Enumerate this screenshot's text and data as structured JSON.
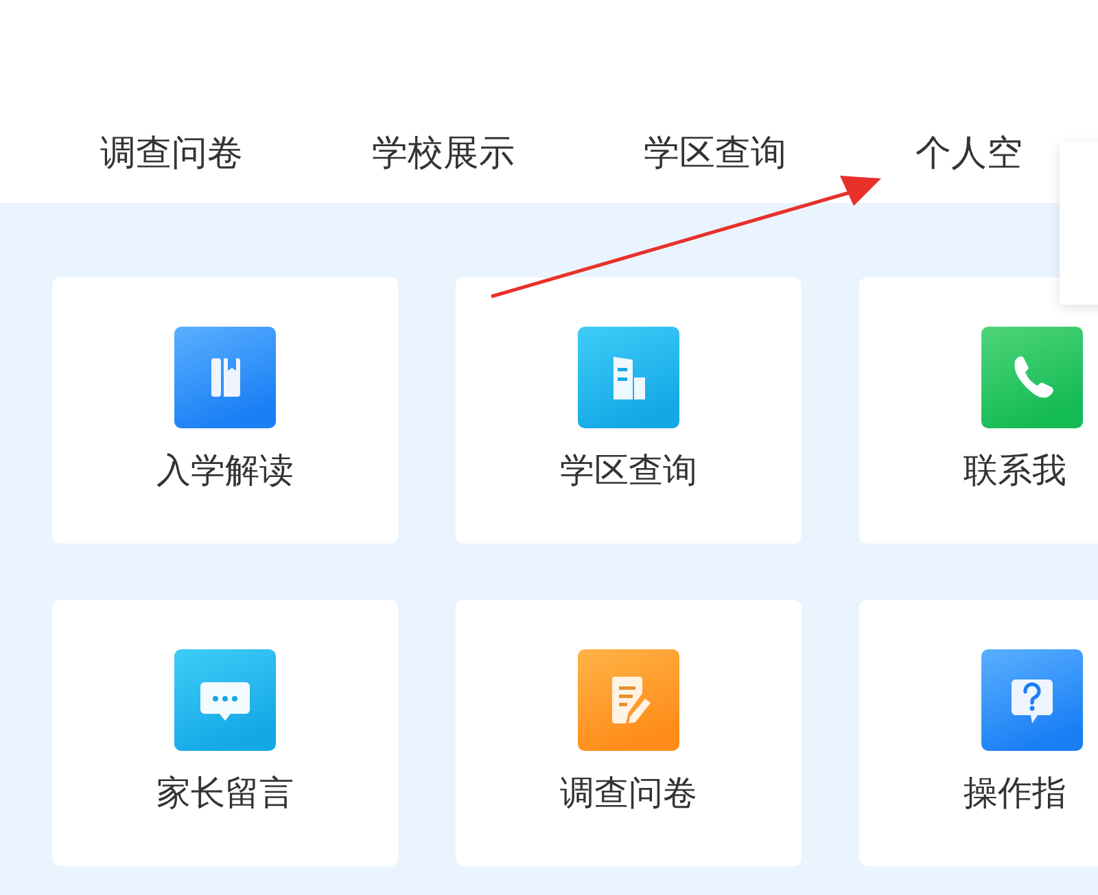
{
  "nav": [
    {
      "label": "调查问卷"
    },
    {
      "label": "学校展示"
    },
    {
      "label": "学区查询"
    },
    {
      "label": "个人空"
    }
  ],
  "tiles": [
    {
      "label": "入学解读",
      "kind": "book"
    },
    {
      "label": "学区查询",
      "kind": "building"
    },
    {
      "label": "联系我",
      "kind": "phone"
    },
    {
      "label": "家长留言",
      "kind": "message"
    },
    {
      "label": "调查问卷",
      "kind": "form"
    },
    {
      "label": "操作指",
      "kind": "help"
    }
  ]
}
